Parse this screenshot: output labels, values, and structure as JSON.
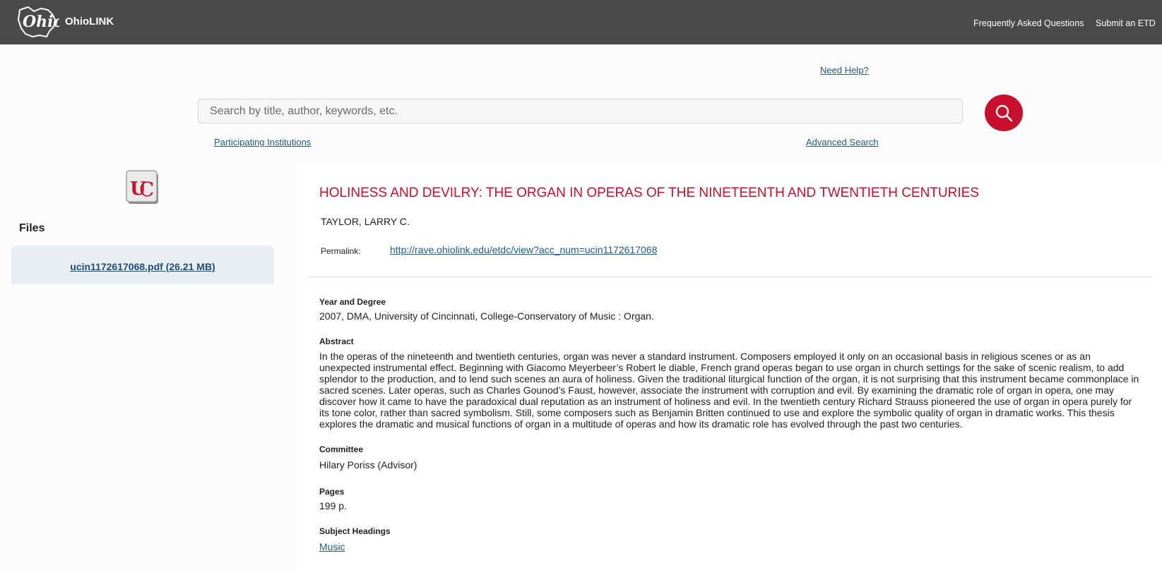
{
  "header": {
    "brand": "OhioLINK",
    "logo_icon": "ohio-state-outline-logo",
    "nav": {
      "faq": "Frequently Asked Questions",
      "submit": "Submit an ETD"
    }
  },
  "search": {
    "need_help": "Need Help?",
    "placeholder": "Search by title, author, keywords, etc.",
    "value": "",
    "button_icon": "search-icon",
    "participating_institutions": "Participating Institutions",
    "advanced_search": "Advanced Search"
  },
  "sidebar": {
    "institution_logo": "uc-logo",
    "files_heading": "Files",
    "file_link": "ucin1172617068.pdf (26.21 MB)"
  },
  "record": {
    "title": "HOLINESS AND DEVILRY: THE ORGAN IN OPERAS OF THE NINETEENTH AND TWENTIETH CENTURIES",
    "author": "TAYLOR, LARRY C.",
    "permalink_label": "Permalink:",
    "permalink": "http://rave.ohiolink.edu/etdc/view?acc_num=ucin1172617068",
    "year_degree_label": "Year and Degree",
    "year_degree": "2007, DMA, University of Cincinnati, College-Conservatory of Music : Organ.",
    "abstract_label": "Abstract",
    "abstract": "In the operas of the nineteenth and twentieth centuries, organ was never a standard instrument. Composers employed it only on an occasional basis in religious scenes or as an unexpected instrumental effect. Beginning with Giacomo Meyerbeer’s Robert le diable, French grand operas began to use organ in church settings for the sake of scenic realism, to add splendor to the production, and to lend such scenes an aura of holiness. Given the traditional liturgical function of the organ, it is not surprising that this instrument became commonplace in sacred scenes. Later operas, such as Charles Gounod’s Faust, however, associate the instrument with corruption and evil. By examining the dramatic role of organ in opera, one may discover how it came to have the paradoxical dual reputation as an instrument of holiness and evil. In the twentieth century Richard Strauss pioneered the use of organ in opera purely for its tone color, rather than sacred symbolism. Still, some composers such as Benjamin Britten continued to use and explore the symbolic quality of organ in dramatic works. This thesis explores the dramatic and musical functions of organ in a multitude of operas and how its dramatic role has evolved through the past two centuries.",
    "committee_label": "Committee",
    "committee": "Hilary Poriss (Advisor)",
    "pages_label": "Pages",
    "pages": "199 p.",
    "subject_label": "Subject Headings",
    "subject": "Music"
  },
  "colors": {
    "header_bg": "#4a4a4a",
    "accent_red": "#c8102e",
    "link_blue": "#1f5c8c",
    "file_box_bg": "#e8eef2"
  }
}
